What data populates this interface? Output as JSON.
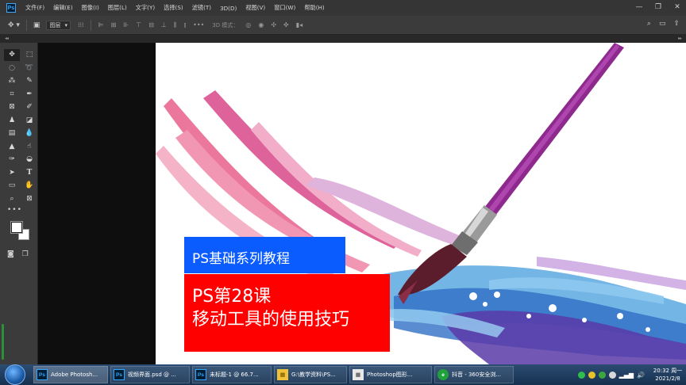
{
  "menubar": {
    "logo": "Ps",
    "items": [
      "文件(F)",
      "编辑(E)",
      "图像(I)",
      "图层(L)",
      "文字(Y)",
      "选择(S)",
      "滤镜(T)",
      "3D(D)",
      "视图(V)",
      "窗口(W)",
      "帮助(H)"
    ]
  },
  "window_controls": {
    "minimize": "—",
    "restore": "❐",
    "close": "✕"
  },
  "options": {
    "layer_select": "图层",
    "mode3d_label": "3D 模式："
  },
  "canvas": {
    "title_blue": "PS基础系列教程",
    "title_red_line1": "PS第28课",
    "title_red_line2": "移动工具的使用技巧",
    "colors": {
      "blue": "#0a5cff",
      "red": "#ff0000",
      "brush_purple": "#8e2a8e"
    }
  },
  "taskbar": {
    "tasks": [
      {
        "label": "Adobe Photosh...",
        "icon": "Ps"
      },
      {
        "label": "视频界面.psd @ ...",
        "icon": "Ps"
      },
      {
        "label": "未标题-1 @ 66.7...",
        "icon": "Ps"
      },
      {
        "label": "G:\\教学资料\\PS...",
        "icon": "▤"
      },
      {
        "label": "Photoshop图形...",
        "icon": "▦"
      },
      {
        "label": "抖音 - 360安全浏...",
        "icon": "e"
      }
    ],
    "clock_time": "20:32 周一",
    "clock_date": "2021/2/8"
  }
}
